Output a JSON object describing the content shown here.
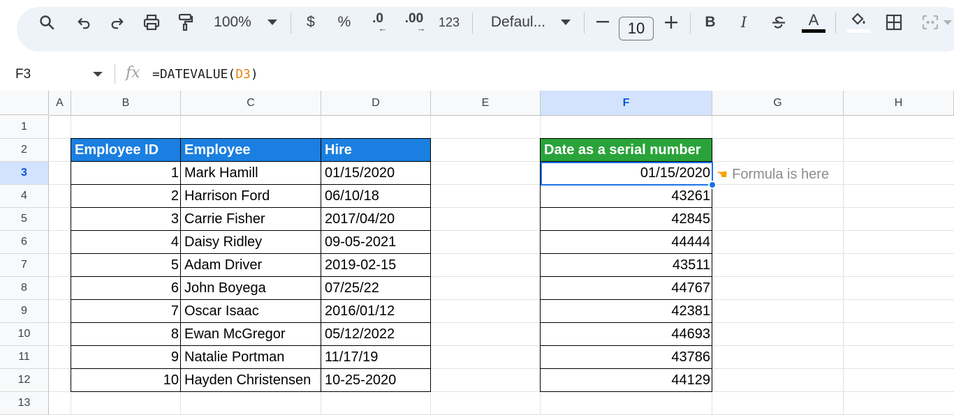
{
  "toolbar": {
    "zoom": "100%",
    "currency": "$",
    "percent": "%",
    "decrease_decimal": ".0",
    "increase_decimal": ".00",
    "number_format": "123",
    "font_name": "Defaul...",
    "font_size": "10",
    "bold": "B",
    "italic": "I",
    "text_color_letter": "A"
  },
  "formula_bar": {
    "cell_ref": "F3",
    "formula_prefix": "=DATEVALUE(",
    "formula_arg": "D3",
    "formula_suffix": ")"
  },
  "columns": [
    "A",
    "B",
    "C",
    "D",
    "E",
    "F",
    "G",
    "H"
  ],
  "rows": [
    "1",
    "2",
    "3",
    "4",
    "5",
    "6",
    "7",
    "8",
    "9",
    "10",
    "11",
    "12",
    "13"
  ],
  "table": {
    "headers": {
      "id": "Employee ID",
      "employee": "Employee",
      "hire": "Hire"
    },
    "rows": [
      {
        "id": "1",
        "employee": "Mark Hamill",
        "hire": "01/15/2020"
      },
      {
        "id": "2",
        "employee": "Harrison Ford",
        "hire": "06/10/18"
      },
      {
        "id": "3",
        "employee": "Carrie Fisher",
        "hire": "2017/04/20"
      },
      {
        "id": "4",
        "employee": "Daisy Ridley",
        "hire": "09-05-2021"
      },
      {
        "id": "5",
        "employee": "Adam Driver",
        "hire": "2019-02-15"
      },
      {
        "id": "6",
        "employee": "John Boyega",
        "hire": "07/25/22"
      },
      {
        "id": "7",
        "employee": "Oscar Isaac",
        "hire": "2016/01/12"
      },
      {
        "id": "8",
        "employee": "Ewan McGregor",
        "hire": "05/12/2022"
      },
      {
        "id": "9",
        "employee": "Natalie Portman",
        "hire": "11/17/19"
      },
      {
        "id": "10",
        "employee": "Hayden Christensen",
        "hire": "10-25-2020"
      }
    ]
  },
  "serial": {
    "header": "Date as a serial number",
    "values": [
      "01/15/2020",
      "43261",
      "42845",
      "44444",
      "43511",
      "44767",
      "42381",
      "44693",
      "43786",
      "44129"
    ]
  },
  "note": {
    "icon": "pointing-hand-icon",
    "text": "Formula is here"
  },
  "colors": {
    "header_blue": "#1a7fe0",
    "header_green": "#2aa33a",
    "selection": "#1a73e8",
    "formula_arg": "#e8870f"
  }
}
